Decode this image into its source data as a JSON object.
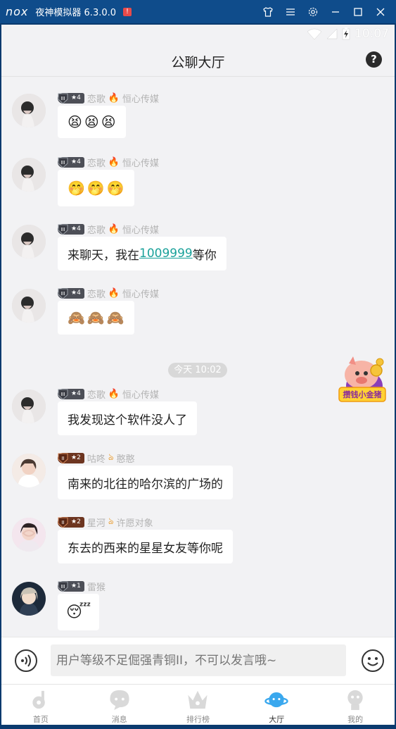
{
  "emulator": {
    "logo": "nox",
    "title": "夜神模拟器 6.3.0.0",
    "alert": "!"
  },
  "status_bar": {
    "time": "10:07"
  },
  "header": {
    "title": "公聊大厅",
    "help": "?"
  },
  "messages": [
    {
      "level": "4",
      "tier": "silver",
      "name": "恋歌",
      "group": "恒心传媒",
      "kind": "emoji",
      "emojis": [
        "😫",
        "😫",
        "😫"
      ]
    },
    {
      "level": "4",
      "tier": "silver",
      "name": "恋歌",
      "group": "恒心传媒",
      "kind": "emoji",
      "emojis": [
        "🤭",
        "🤭",
        "🤭"
      ]
    },
    {
      "level": "4",
      "tier": "silver",
      "name": "恋歌",
      "group": "恒心传媒",
      "kind": "text_link",
      "prefix": "来聊天，我在",
      "link": "1009999",
      "suffix": "等你"
    },
    {
      "level": "4",
      "tier": "silver",
      "name": "恋歌",
      "group": "恒心传媒",
      "kind": "emoji",
      "emojis": [
        "🙈",
        "🙈",
        "🙈"
      ]
    },
    {
      "level": "4",
      "tier": "silver",
      "name": "恋歌",
      "group": "恒心传媒",
      "kind": "text",
      "text": "我发现这个软件没人了"
    },
    {
      "level": "2",
      "tier": "bronze",
      "name": "咕咚",
      "group": "憨憨",
      "kind": "text",
      "text": "南来的北往的哈尔滨的广场的"
    },
    {
      "level": "2",
      "tier": "bronze",
      "name": "星河",
      "group": "许愿对象",
      "kind": "text",
      "text": "东去的西来的星星女友等你呢"
    },
    {
      "level": "1",
      "tier": "silver",
      "name": "雷猴",
      "group": "",
      "kind": "emoji",
      "emojis": [
        "😴"
      ]
    }
  ],
  "time_divider": "今天 10:02",
  "promo": {
    "label": "攒钱小金猪"
  },
  "input": {
    "placeholder": "用户等级不足倔强青铜II，不可以发言哦~"
  },
  "nav": {
    "items": [
      {
        "label": "首页",
        "icon": "music-note-icon"
      },
      {
        "label": "消息",
        "icon": "chat-bubble-icon"
      },
      {
        "label": "排行榜",
        "icon": "crown-icon"
      },
      {
        "label": "大厅",
        "icon": "planet-icon"
      },
      {
        "label": "我的",
        "icon": "profile-icon"
      }
    ],
    "active_index": 3
  },
  "colors": {
    "accent": "#1aa19a",
    "active_tab": "#3aa8ee",
    "emulator_bar": "#0f4c8b"
  }
}
